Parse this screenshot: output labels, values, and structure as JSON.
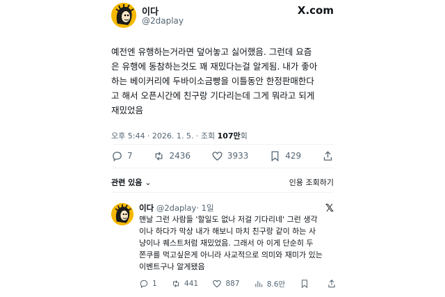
{
  "main_post": {
    "author_name": "이다",
    "author_handle": "@2daplay",
    "brand": "X.com",
    "text_lines": [
      "예전엔 유행하는거라면 덮어놓고 싫어했음. 그런데 요즘",
      "은 유행에 동참하는것도 꽤 재밌다는걸 알게됨. 내가 좋아",
      "하는 베이커리에 두바이소금빵을 이틀동안 한정판매한다",
      "고 해서 오픈시간에 친구랑 기다리는데 그게 뭐라고 되게",
      "재밌었음"
    ],
    "timestamp": "오후 5:44 · 2026. 1. 5. · 조회 ",
    "views": "107만",
    "views_suffix": "회",
    "stats": {
      "replies": "7",
      "reposts": "2436",
      "likes": "3933",
      "bookmarks": "429"
    },
    "related_label": "관련 있음",
    "quote_views_label": "인용 조회하기"
  },
  "reply": {
    "author_name": "이다",
    "author_handle": "@2daplay",
    "time": "· 1일",
    "text_lines": [
      "맨날 그런 사람들 '할일도 없나 저걸 기다리네' 그런 생각",
      "이나 하다가 막상 내가 해보니 마치 친구랑 같이 하는 사",
      "냥이나 퀘스트처럼 재밌었음. 그래서 아 이게 단순히 두",
      "쫀쿠를 먹고싶은게 아니라 사교적으로 의미와 재미가 있는",
      "이벤트구나 알게됐음"
    ],
    "stats": {
      "replies": "1",
      "reposts": "441",
      "likes": "887",
      "views": "8.6만"
    }
  },
  "icons": [
    "avatar-cartoon",
    "x-logo",
    "reply-icon",
    "repost-icon",
    "heart-icon",
    "bookmark-icon",
    "share-icon",
    "views-icon",
    "chevron-down-icon"
  ],
  "colors": {
    "text": "#0f1419",
    "muted": "#536471",
    "avatar_bg": "#f5b800"
  }
}
